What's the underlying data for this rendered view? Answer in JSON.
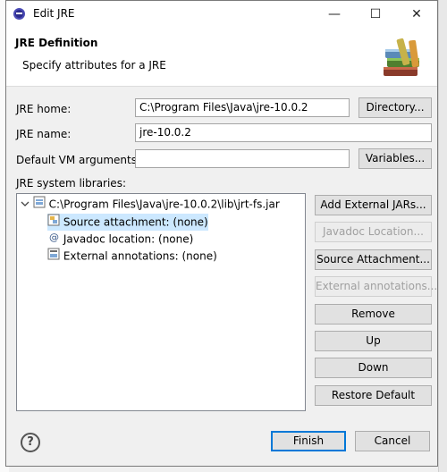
{
  "window": {
    "title": "Edit JRE",
    "minimize": "—",
    "maximize": "☐",
    "close": "✕"
  },
  "header": {
    "title": "JRE Definition",
    "subtitle": "Specify attributes for a JRE"
  },
  "form": {
    "jre_home_label": "JRE home:",
    "jre_home_value": "C:\\Program Files\\Java\\jre-10.0.2",
    "directory_button": "Directory...",
    "jre_name_label": "JRE name:",
    "jre_name_value": "jre-10.0.2",
    "vm_args_label": "Default VM arguments:",
    "vm_args_value": "",
    "variables_button": "Variables...",
    "libraries_label": "JRE system libraries:"
  },
  "tree": {
    "root": "C:\\Program Files\\Java\\jre-10.0.2\\lib\\jrt-fs.jar",
    "children": [
      "Source attachment: (none)",
      "Javadoc location: (none)",
      "External annotations: (none)"
    ]
  },
  "side_buttons": {
    "add_external_jars": "Add External JARs...",
    "javadoc_location": "Javadoc Location...",
    "source_attachment": "Source Attachment...",
    "external_annotations": "External annotations...",
    "remove": "Remove",
    "up": "Up",
    "down": "Down",
    "restore_default": "Restore Default"
  },
  "footer": {
    "help": "?",
    "finish": "Finish",
    "cancel": "Cancel"
  }
}
